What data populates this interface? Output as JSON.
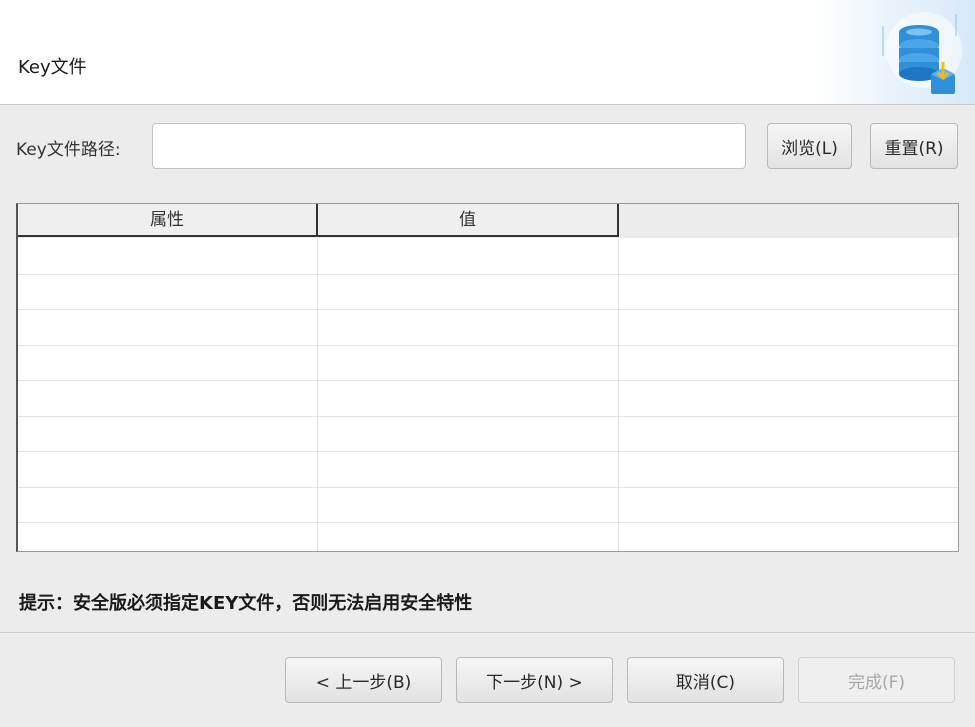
{
  "header": {
    "title": "Key文件",
    "logo_icon": "database-download-icon"
  },
  "key_path": {
    "label": "Key文件路径:",
    "value": "",
    "placeholder": "",
    "browse_label": "浏览(L)",
    "reset_label": "重置(R)"
  },
  "table": {
    "columns": [
      "属性",
      "值",
      ""
    ],
    "rows": [
      [
        "",
        "",
        ""
      ],
      [
        "",
        "",
        ""
      ],
      [
        "",
        "",
        ""
      ],
      [
        "",
        "",
        ""
      ],
      [
        "",
        "",
        ""
      ],
      [
        "",
        "",
        ""
      ],
      [
        "",
        "",
        ""
      ],
      [
        "",
        "",
        ""
      ],
      [
        "",
        "",
        ""
      ]
    ]
  },
  "hint": "提示：安全版必须指定KEY文件，否则无法启用安全特性",
  "footer": {
    "back_label": "< 上一步(B)",
    "next_label": "下一步(N) >",
    "cancel_label": "取消(C)",
    "finish_label": "完成(F)"
  },
  "colors": {
    "accent": "#2f8fd8",
    "background": "#ececec"
  }
}
